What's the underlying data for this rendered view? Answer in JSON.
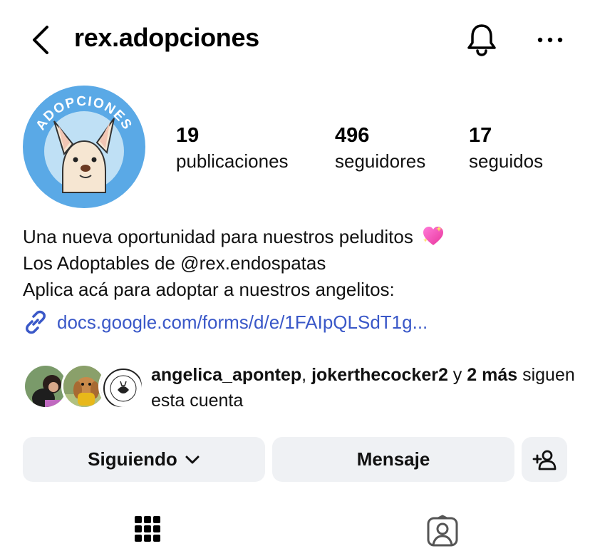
{
  "header": {
    "username": "rex.adopciones"
  },
  "stats": {
    "posts": {
      "count": "19",
      "label": "publicaciones"
    },
    "followers": {
      "count": "496",
      "label": "seguidores"
    },
    "following": {
      "count": "17",
      "label": "seguidos"
    }
  },
  "avatar": {
    "ring_text": "ADOPCIONES"
  },
  "bio": {
    "line1": "Una nueva oportunidad para nuestros peluditos",
    "line1_emoji": "sparkling-heart",
    "line2": "Los Adoptables de @rex.endospatas",
    "line3": "Aplica acá para adoptar a nuestros angelitos:",
    "link": "docs.google.com/forms/d/e/1FAIpQLSdT1g..."
  },
  "mutual": {
    "user1": "angelica_apontep",
    "separator": ", ",
    "user2": "jokerthecocker2",
    "and": " y ",
    "more": "2 más",
    "suffix": " siguen esta cuenta"
  },
  "buttons": {
    "following": "Siguiendo",
    "message": "Mensaje"
  },
  "colors": {
    "link": "#3a58c8",
    "button_bg": "#eff1f4",
    "avatar_bg": "#5aa9e6"
  }
}
